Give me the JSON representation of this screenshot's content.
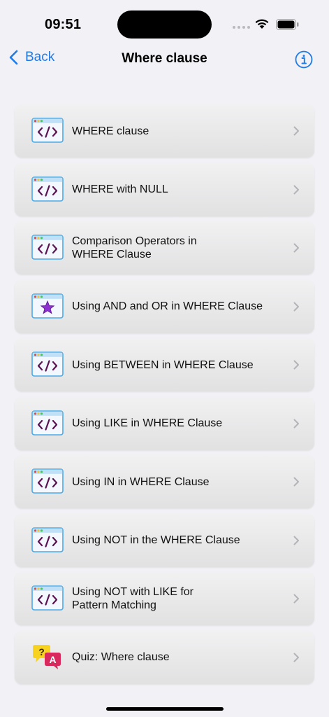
{
  "status": {
    "time": "09:51"
  },
  "nav": {
    "back_label": "Back",
    "title": "Where clause"
  },
  "items": [
    {
      "label": "WHERE clause",
      "icon": "code-window-icon"
    },
    {
      "label": "WHERE with NULL",
      "icon": "code-window-icon"
    },
    {
      "label": "Comparison Operators in\nWHERE Clause",
      "icon": "code-window-icon"
    },
    {
      "label": "Using AND and OR in WHERE Clause",
      "icon": "star-window-icon"
    },
    {
      "label": "Using BETWEEN in WHERE Clause",
      "icon": "code-window-icon"
    },
    {
      "label": "Using LIKE in WHERE Clause",
      "icon": "code-window-icon"
    },
    {
      "label": "Using IN in WHERE Clause",
      "icon": "code-window-icon"
    },
    {
      "label": "Using NOT in the WHERE Clause",
      "icon": "code-window-icon"
    },
    {
      "label": "Using NOT with LIKE for\nPattern Matching",
      "icon": "code-window-icon"
    },
    {
      "label": "Quiz: Where clause",
      "icon": "quiz-icon"
    }
  ],
  "colors": {
    "accent": "#1f7ae6",
    "background": "#f2f1f6",
    "code_purple": "#5b1250",
    "star_purple": "#8e2fd1",
    "quiz_yellow": "#f7d21e",
    "quiz_pink": "#d8285d"
  }
}
